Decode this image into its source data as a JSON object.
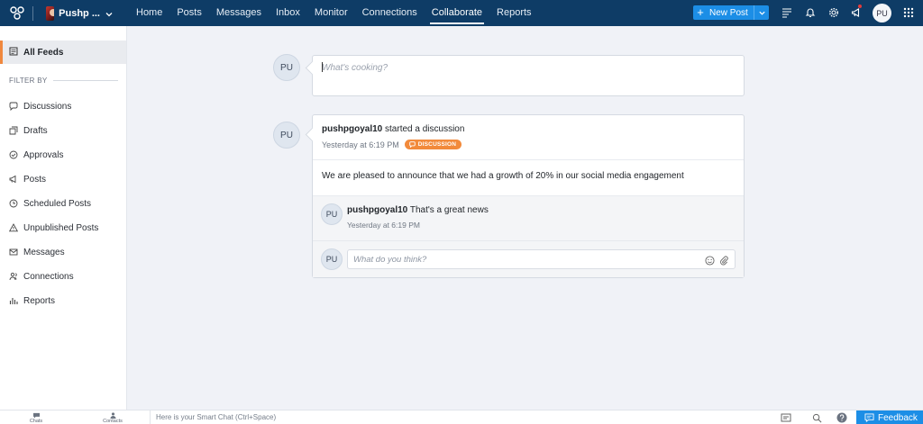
{
  "topbar": {
    "brand_name": "Pushp ...",
    "nav": [
      "Home",
      "Posts",
      "Messages",
      "Inbox",
      "Monitor",
      "Connections",
      "Collaborate",
      "Reports"
    ],
    "active_nav": "Collaborate",
    "new_post_label": "New Post",
    "avatar_initials": "PU",
    "icons": [
      "app-logo-icon",
      "chevron-down-icon",
      "plus-icon",
      "list-icon",
      "bell-icon",
      "gear-icon",
      "megaphone-icon",
      "grid-icon"
    ],
    "colors": {
      "bar": "#0e3c66",
      "accent": "#1c8ee6"
    }
  },
  "sidebar": {
    "all_feeds": "All Feeds",
    "filter_label": "FILTER BY",
    "items": [
      {
        "label": "Discussions",
        "icon": "chat-bubble-icon"
      },
      {
        "label": "Drafts",
        "icon": "drafts-icon"
      },
      {
        "label": "Approvals",
        "icon": "check-circle-icon"
      },
      {
        "label": "Posts",
        "icon": "megaphone-icon"
      },
      {
        "label": "Scheduled Posts",
        "icon": "clock-icon"
      },
      {
        "label": "Unpublished Posts",
        "icon": "warning-icon"
      },
      {
        "label": "Messages",
        "icon": "envelope-icon"
      },
      {
        "label": "Connections",
        "icon": "people-icon"
      },
      {
        "label": "Reports",
        "icon": "bar-chart-icon"
      }
    ],
    "active_color": "#f0883e"
  },
  "compose": {
    "avatar_initials": "PU",
    "placeholder": "What's cooking?"
  },
  "post": {
    "avatar_initials": "PU",
    "user": "pushpgoyal10",
    "action": "started a discussion",
    "time": "Yesterday at 6:19 PM",
    "badge": "DISCUSSION",
    "body": "We are pleased to announce that we had a growth of 20% in our social media engagement",
    "badge_color": "#f28a3b"
  },
  "comment": {
    "avatar_initials": "PU",
    "user": "pushpgoyal10",
    "text": "That's a great news",
    "time": "Yesterday at 6:19 PM"
  },
  "reply": {
    "avatar_initials": "PU",
    "placeholder": "What do you think?"
  },
  "bottombar": {
    "chats": "Chats",
    "contacts": "Contacts",
    "smart_chat": "Here is your Smart Chat (Ctrl+Space)",
    "feedback": "Feedback"
  }
}
